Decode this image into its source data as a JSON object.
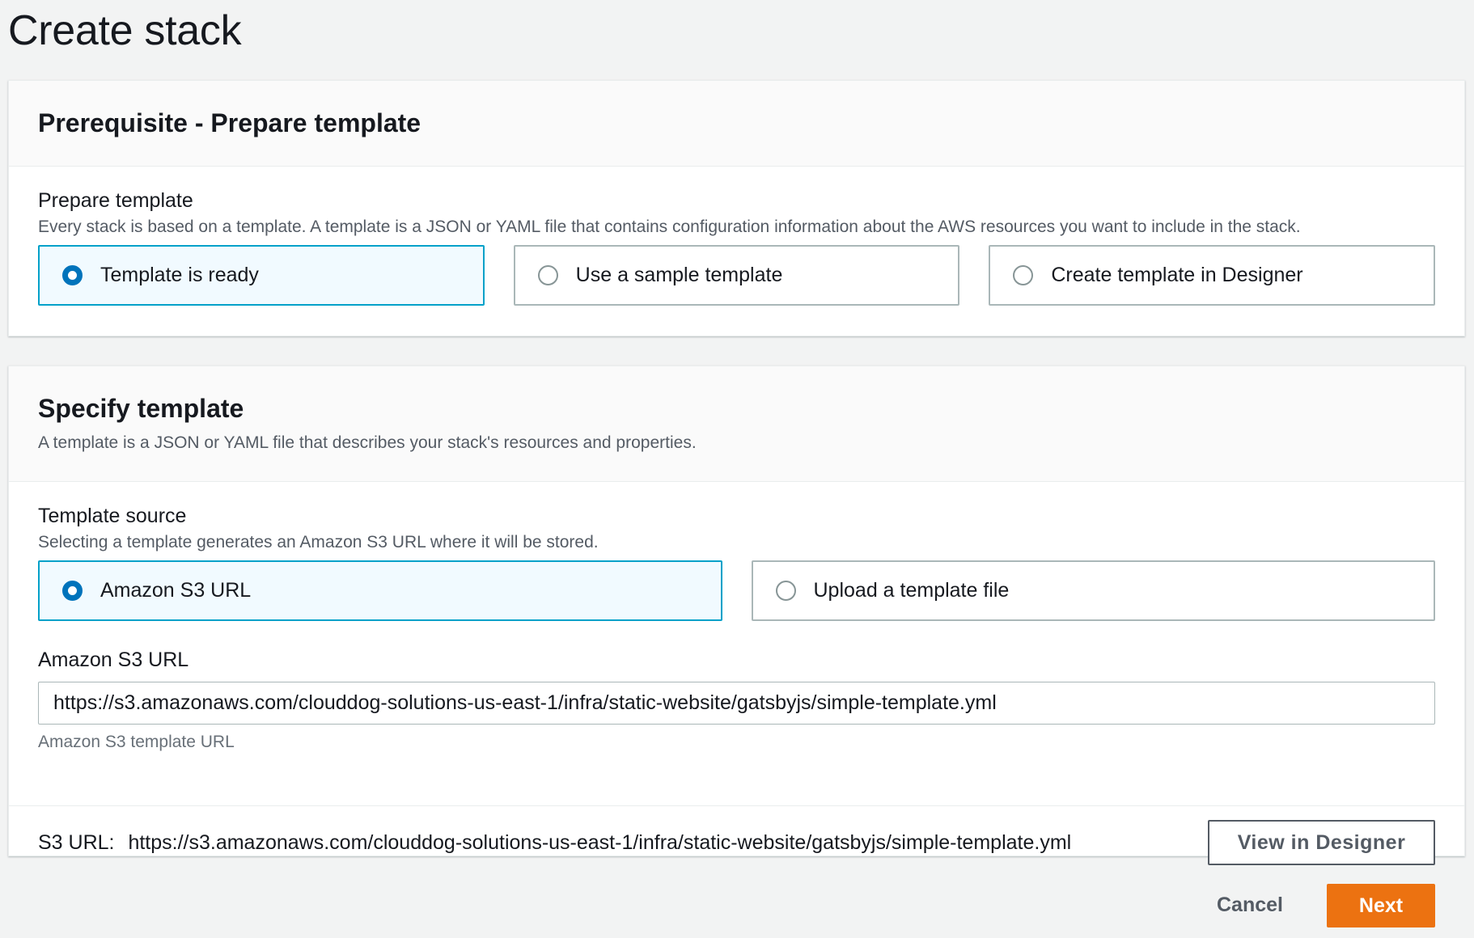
{
  "page": {
    "title": "Create stack"
  },
  "prerequisite": {
    "heading": "Prerequisite - Prepare template",
    "field_label": "Prepare template",
    "field_description": "Every stack is based on a template. A template is a JSON or YAML file that contains configuration information about the AWS resources you want to include in the stack.",
    "options": [
      {
        "label": "Template is ready",
        "selected": true
      },
      {
        "label": "Use a sample template",
        "selected": false
      },
      {
        "label": "Create template in Designer",
        "selected": false
      }
    ]
  },
  "specify": {
    "heading": "Specify template",
    "description": "A template is a JSON or YAML file that describes your stack's resources and properties.",
    "source_label": "Template source",
    "source_description": "Selecting a template generates an Amazon S3 URL where it will be stored.",
    "source_options": [
      {
        "label": "Amazon S3 URL",
        "selected": true
      },
      {
        "label": "Upload a template file",
        "selected": false
      }
    ],
    "url_label": "Amazon S3 URL",
    "url_value": "https://s3.amazonaws.com/clouddog-solutions-us-east-1/infra/static-website/gatsbyjs/simple-template.yml",
    "url_hint": "Amazon S3 template URL",
    "s3_url_prefix": "S3 URL:",
    "s3_url_value": "https://s3.amazonaws.com/clouddog-solutions-us-east-1/infra/static-website/gatsbyjs/simple-template.yml",
    "view_designer_label": "View in Designer"
  },
  "footer": {
    "cancel_label": "Cancel",
    "next_label": "Next"
  },
  "colors": {
    "accent": "#0073bb",
    "selected_border": "#00a1c9",
    "selected_bg": "#f1faff",
    "primary_button": "#ec7211",
    "background": "#f2f3f3"
  }
}
